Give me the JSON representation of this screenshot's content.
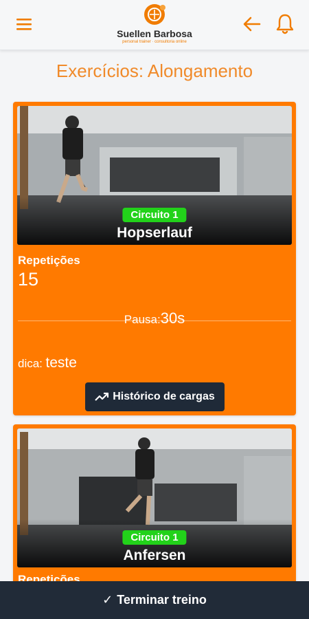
{
  "header": {
    "brand_name": "Suellen Barbosa",
    "brand_subtitle": "personal trainer · consultoria online",
    "icons": {
      "menu": "hamburger-menu-icon",
      "back": "arrow-left-icon",
      "bell": "bell-icon"
    }
  },
  "page": {
    "title": "Exercícios: Alongamento"
  },
  "exercises": [
    {
      "circuit": "Circuito 1",
      "name": "Hopserlauf",
      "reps_label": "Repetições",
      "reps_value": "15",
      "pause_label": "Pausa:",
      "pause_value": "30s",
      "tip_label": "dica:",
      "tip_value": "teste",
      "history_label": "Histórico de cargas"
    },
    {
      "circuit": "Circuito 1",
      "name": "Anfersen",
      "reps_label": "Repetições"
    }
  ],
  "footer": {
    "finish_label": "Terminar treino",
    "finish_icon": "check-icon"
  },
  "colors": {
    "accent": "#ff7a00",
    "dark": "#212b38",
    "badge": "#22d21a",
    "title": "#f08a2a"
  }
}
